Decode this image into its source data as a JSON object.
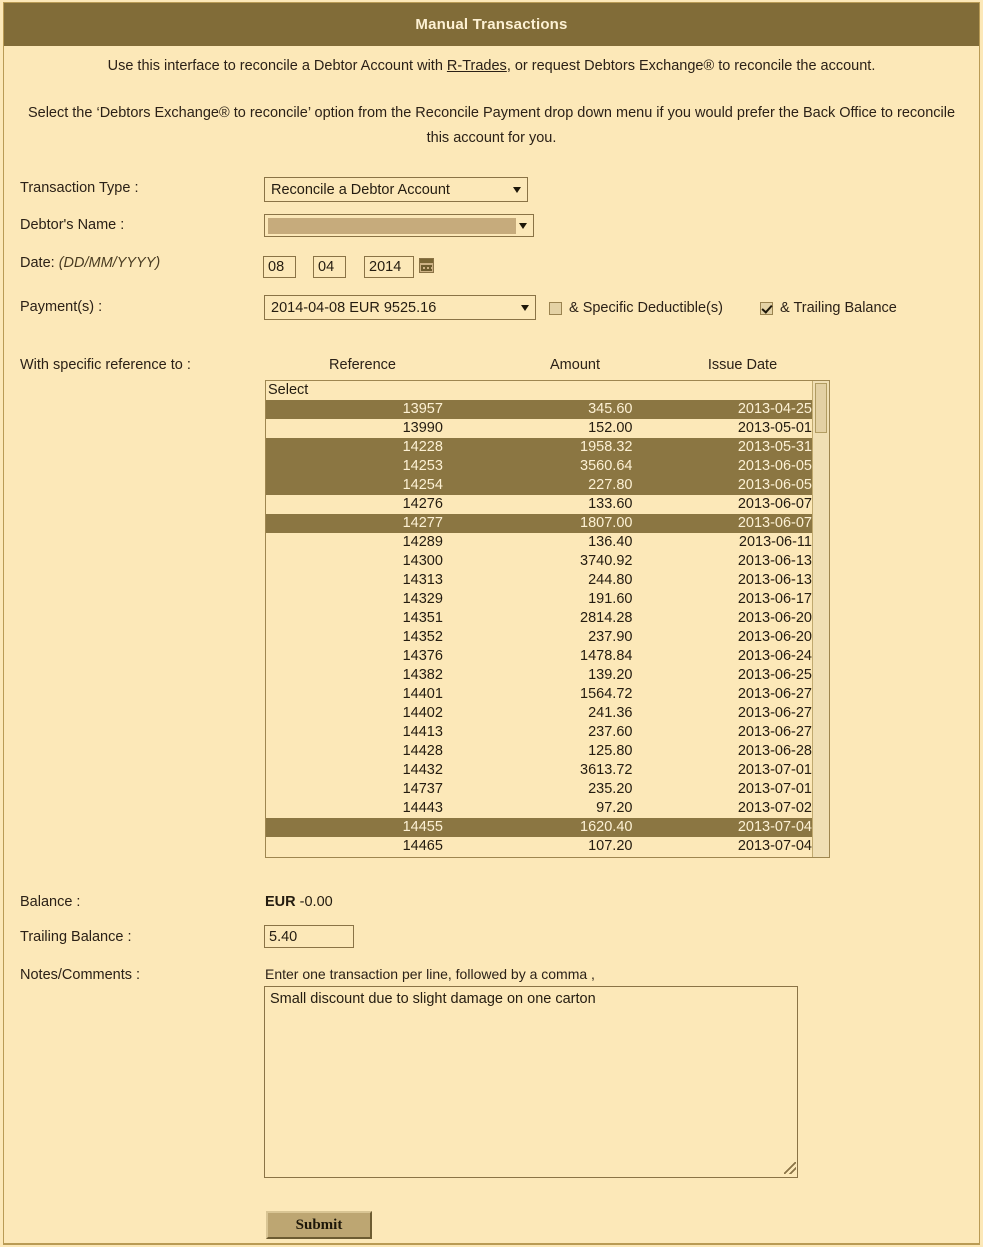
{
  "window": {
    "title": "Manual Transactions"
  },
  "intro": {
    "line1_before": "Use this interface to reconcile a Debtor Account with ",
    "line1_link": "R-Trades",
    "line1_after": ", or request Debtors Exchange® to reconcile the account.",
    "line2": "Select the ‘Debtors Exchange® to reconcile’ option from the Reconcile Payment drop down menu if you would prefer the Back Office to reconcile this account for you."
  },
  "form": {
    "transaction_type_label": "Transaction Type :",
    "transaction_type_value": "Reconcile a Debtor Account",
    "debtor_name_label": "Debtor's Name :",
    "debtor_name_value": "",
    "date_label": "Date:",
    "date_format_hint": "(DD/MM/YYYY)",
    "date_day": "08",
    "date_month": "04",
    "date_year": "2014",
    "payments_label": "Payment(s) :",
    "payments_value": "2014-04-08   EUR   9525.16",
    "specific_deductibles_label": "& Specific Deductible(s)",
    "specific_deductibles_checked": false,
    "trailing_balance_checkbox_label": "& Trailing Balance",
    "trailing_balance_checked": true,
    "reference_label": "With specific reference to :",
    "balance_label": "Balance :",
    "balance_currency": "EUR",
    "balance_amount": "-0.00",
    "trailing_balance_label": "Trailing Balance :",
    "trailing_balance_value": "5.40",
    "notes_label": "Notes/Comments :",
    "notes_hint": "Enter one transaction per line, followed by a comma ,",
    "notes_value": "Small discount due to slight damage on one carton",
    "submit_label": "Submit"
  },
  "transactions_list": {
    "columns": [
      "Reference",
      "Amount",
      "Issue Date"
    ],
    "placeholder_option": "Select",
    "rows": [
      {
        "reference": "13957",
        "amount": "345.60",
        "issue_date": "2013-04-25",
        "selected": true
      },
      {
        "reference": "13990",
        "amount": "152.00",
        "issue_date": "2013-05-01",
        "selected": false
      },
      {
        "reference": "14228",
        "amount": "1958.32",
        "issue_date": "2013-05-31",
        "selected": true
      },
      {
        "reference": "14253",
        "amount": "3560.64",
        "issue_date": "2013-06-05",
        "selected": true
      },
      {
        "reference": "14254",
        "amount": "227.80",
        "issue_date": "2013-06-05",
        "selected": true
      },
      {
        "reference": "14276",
        "amount": "133.60",
        "issue_date": "2013-06-07",
        "selected": false
      },
      {
        "reference": "14277",
        "amount": "1807.00",
        "issue_date": "2013-06-07",
        "selected": true
      },
      {
        "reference": "14289",
        "amount": "136.40",
        "issue_date": "2013-06-11",
        "selected": false
      },
      {
        "reference": "14300",
        "amount": "3740.92",
        "issue_date": "2013-06-13",
        "selected": false
      },
      {
        "reference": "14313",
        "amount": "244.80",
        "issue_date": "2013-06-13",
        "selected": false
      },
      {
        "reference": "14329",
        "amount": "191.60",
        "issue_date": "2013-06-17",
        "selected": false
      },
      {
        "reference": "14351",
        "amount": "2814.28",
        "issue_date": "2013-06-20",
        "selected": false
      },
      {
        "reference": "14352",
        "amount": "237.90",
        "issue_date": "2013-06-20",
        "selected": false
      },
      {
        "reference": "14376",
        "amount": "1478.84",
        "issue_date": "2013-06-24",
        "selected": false
      },
      {
        "reference": "14382",
        "amount": "139.20",
        "issue_date": "2013-06-25",
        "selected": false
      },
      {
        "reference": "14401",
        "amount": "1564.72",
        "issue_date": "2013-06-27",
        "selected": false
      },
      {
        "reference": "14402",
        "amount": "241.36",
        "issue_date": "2013-06-27",
        "selected": false
      },
      {
        "reference": "14413",
        "amount": "237.60",
        "issue_date": "2013-06-27",
        "selected": false
      },
      {
        "reference": "14428",
        "amount": "125.80",
        "issue_date": "2013-06-28",
        "selected": false
      },
      {
        "reference": "14432",
        "amount": "3613.72",
        "issue_date": "2013-07-01",
        "selected": false
      },
      {
        "reference": "14737",
        "amount": "235.20",
        "issue_date": "2013-07-01",
        "selected": false
      },
      {
        "reference": "14443",
        "amount": "97.20",
        "issue_date": "2013-07-02",
        "selected": false
      },
      {
        "reference": "14455",
        "amount": "1620.40",
        "issue_date": "2013-07-04",
        "selected": true
      },
      {
        "reference": "14465",
        "amount": "107.20",
        "issue_date": "2013-07-04",
        "selected": false
      }
    ]
  },
  "icons": {
    "calendar": "calendar-icon",
    "dropdown_arrow": "chevron-down-icon"
  },
  "colors": {
    "header_bar": "#816c38",
    "page_background": "#fce8b8",
    "selected_row": "#8b7642",
    "border": "#8a7346",
    "button_face": "#bda672"
  }
}
